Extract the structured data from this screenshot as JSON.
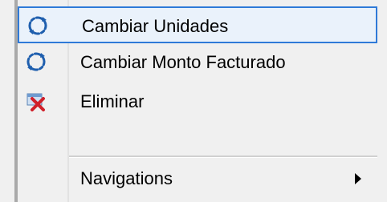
{
  "menu": {
    "items": [
      {
        "label": "Cambiar Unidades",
        "icon": "refresh-icon",
        "highlighted": true
      },
      {
        "label": "Cambiar Monto Facturado",
        "icon": "refresh-icon",
        "highlighted": false
      },
      {
        "label": "Eliminar",
        "icon": "delete-icon",
        "highlighted": false
      },
      {
        "label": "Navigations",
        "icon": "",
        "has_submenu": true
      }
    ]
  },
  "colors": {
    "highlight_border": "#2f7ad8",
    "highlight_fill": "#eaf2fb",
    "refresh_icon": "#1f5fae",
    "delete_icon": "#d0202a"
  }
}
